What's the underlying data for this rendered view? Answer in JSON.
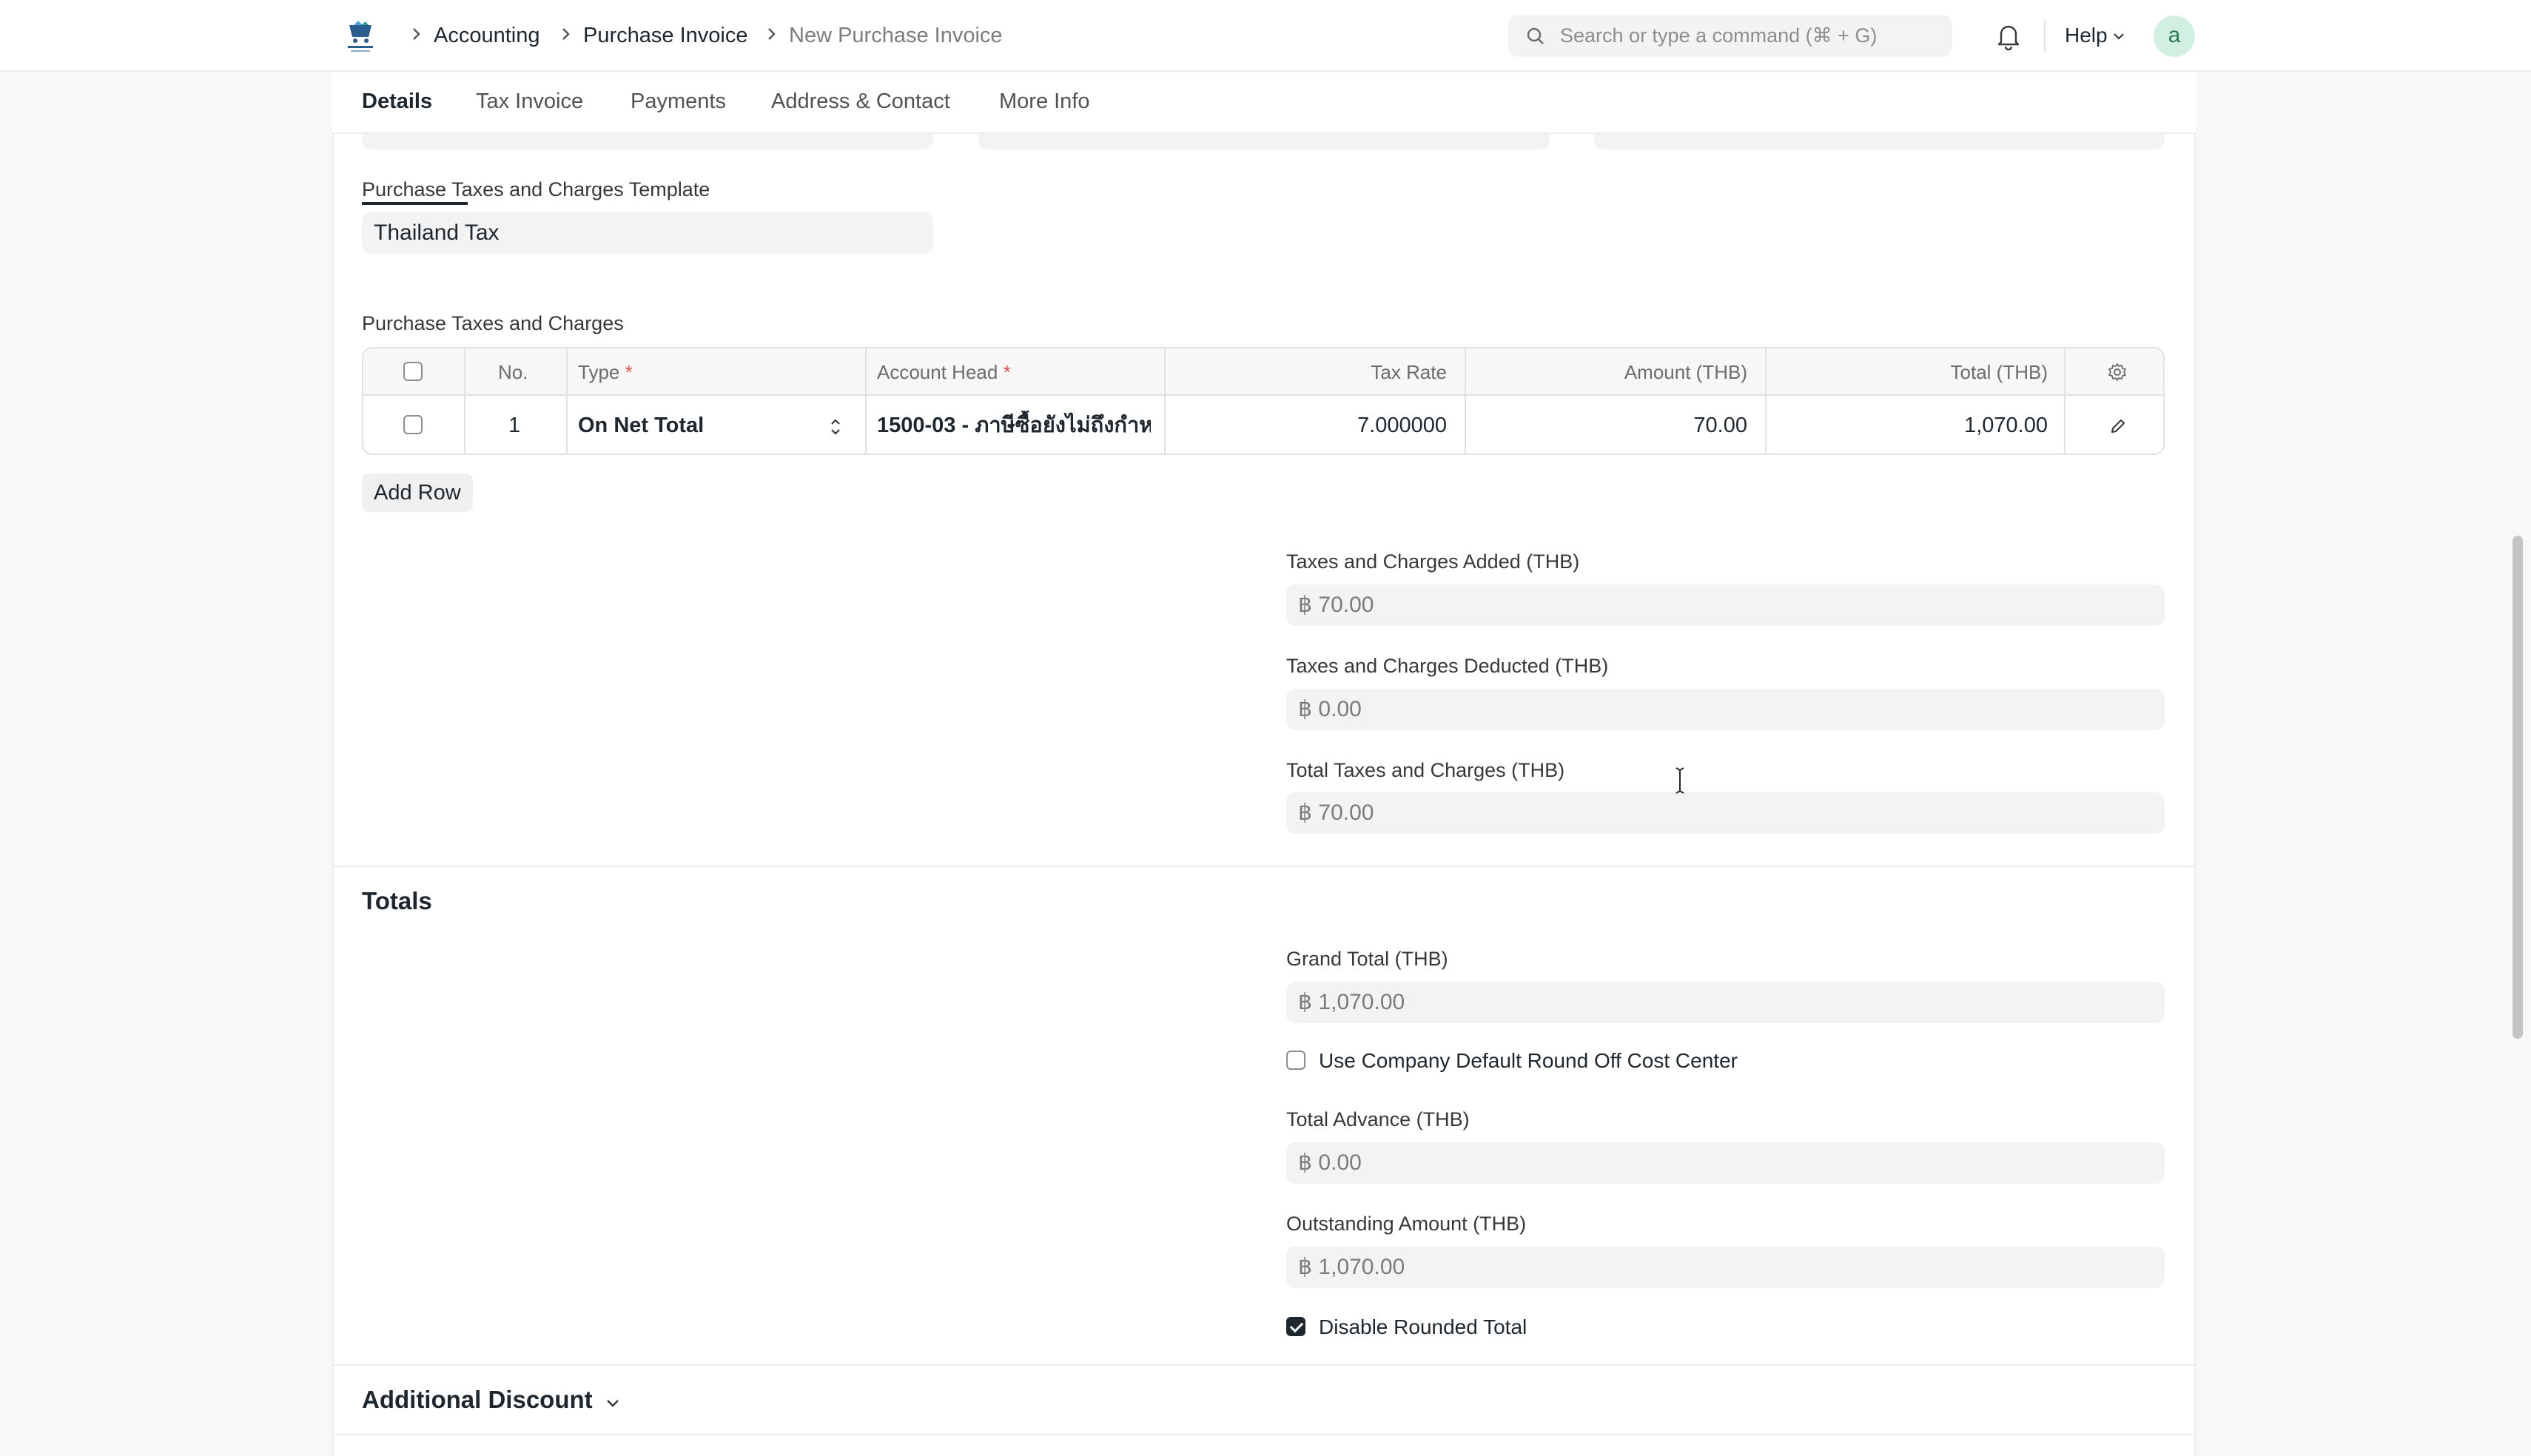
{
  "navbar": {
    "breadcrumbs": [
      "Accounting",
      "Purchase Invoice",
      "New Purchase Invoice"
    ],
    "search_placeholder": "Search or type a command (⌘ + G)",
    "help_label": "Help",
    "avatar_initial": "a"
  },
  "tabs": [
    "Details",
    "Tax Invoice",
    "Payments",
    "Address & Contact",
    "More Info"
  ],
  "active_tab": "Details",
  "taxes_template": {
    "label": "Purchase Taxes and Charges Template",
    "value": "Thailand Tax"
  },
  "taxes_table": {
    "label": "Purchase Taxes and Charges",
    "headers": {
      "no": "No.",
      "type": "Type",
      "account_head": "Account Head",
      "tax_rate": "Tax Rate",
      "amount": "Amount (THB)",
      "total": "Total (THB)"
    },
    "required_mark": "*",
    "rows": [
      {
        "no": "1",
        "type": "On Net Total",
        "account_head": "1500-03 - ภาษีซื้อยังไม่ถึงกำห",
        "tax_rate": "7.000000",
        "amount": "70.00",
        "total": "1,070.00"
      }
    ],
    "add_row_label": "Add Row"
  },
  "tax_summary": {
    "added_label": "Taxes and Charges Added (THB)",
    "added_value": "฿ 70.00",
    "deducted_label": "Taxes and Charges Deducted (THB)",
    "deducted_value": "฿ 0.00",
    "total_label": "Total Taxes and Charges (THB)",
    "total_value": "฿ 70.00"
  },
  "totals": {
    "section_title": "Totals",
    "grand_total_label": "Grand Total (THB)",
    "grand_total_value": "฿ 1,070.00",
    "round_off_label": "Use Company Default Round Off Cost Center",
    "round_off_checked": false,
    "advance_label": "Total Advance (THB)",
    "advance_value": "฿ 0.00",
    "outstanding_label": "Outstanding Amount (THB)",
    "outstanding_value": "฿ 1,070.00",
    "disable_rounded_label": "Disable Rounded Total",
    "disable_rounded_checked": true
  },
  "additional_discount": {
    "section_title": "Additional Discount"
  },
  "colors": {
    "text": "#1f272e",
    "muted": "#7c7c7c",
    "field_bg": "#f3f3f3",
    "required": "#e24c4c",
    "avatar_bg": "#d1f0e1",
    "avatar_text": "#2d7a54"
  }
}
